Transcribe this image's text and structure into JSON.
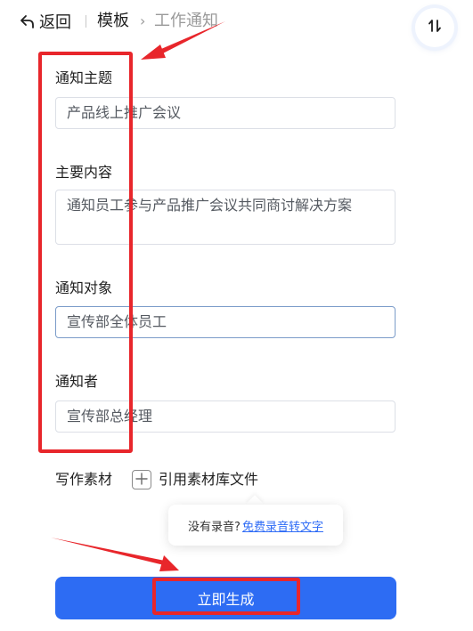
{
  "header": {
    "back_label": "返回",
    "breadcrumb_template": "模板",
    "breadcrumb_separator": "›",
    "breadcrumb_current": "工作通知",
    "back_icon": "back-arrow-icon",
    "sort_icon": "sort-toggle-icon"
  },
  "form": {
    "topic": {
      "label": "通知主题",
      "value": "产品线上推广会议"
    },
    "content": {
      "label": "主要内容",
      "value": "通知员工参与产品推广会议共同商讨解决方案"
    },
    "audience": {
      "label": "通知对象",
      "value": "宣传部全体员工"
    },
    "sender": {
      "label": "通知者",
      "value": "宣传部总经理"
    }
  },
  "material": {
    "label": "写作素材",
    "plus_icon": "plus-icon",
    "link_label": "引用素材库文件"
  },
  "tooltip": {
    "text": "没有录音?",
    "link": "免费录音转文字"
  },
  "generate_button": "立即生成",
  "colors": {
    "primary": "#2d6cf3",
    "annotation_red": "#e8262b",
    "link_blue": "#2f6cf6",
    "focus_border": "#7b9cc9"
  }
}
